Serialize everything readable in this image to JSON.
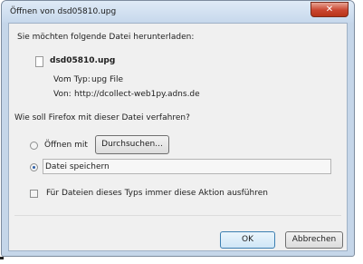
{
  "window": {
    "title": "Öffnen von dsd05810.upg",
    "close_label": "✕"
  },
  "prompt": "Sie möchten folgende Datei herunterladen:",
  "file": {
    "name": "dsd05810.upg",
    "type_label": "Vom Typ:",
    "type_value": "upg File",
    "from_label": "Von:",
    "from_value": "http://dcollect-web1py.adns.de"
  },
  "question": "Wie soll Firefox mit dieser Datei verfahren?",
  "options": {
    "open_with_label": "Öffnen mit",
    "browse_button": "Durchsuchen...",
    "save_label": "Datei speichern",
    "save_selected": true,
    "always_label": "Für Dateien dieses Typs immer diese Aktion ausführen",
    "always_checked": false
  },
  "buttons": {
    "ok": "OK",
    "cancel": "Abbrechen"
  }
}
